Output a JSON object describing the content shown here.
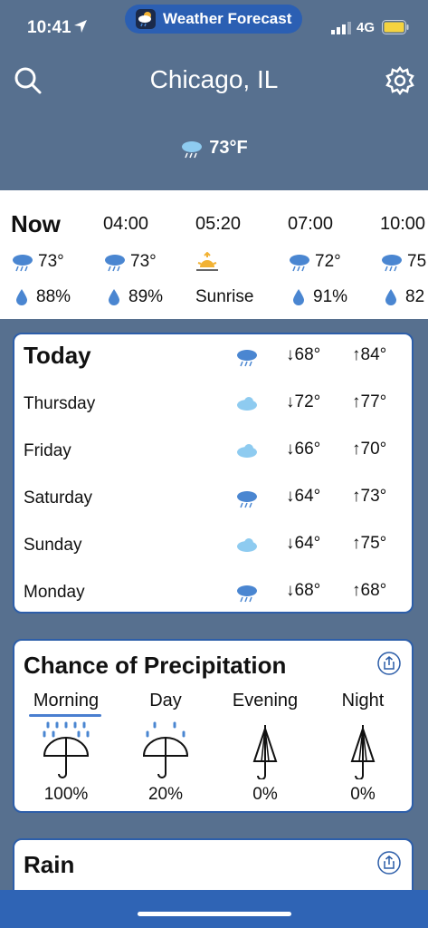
{
  "status": {
    "time": "10:41",
    "network": "4G"
  },
  "app": {
    "name": "Weather Forecast"
  },
  "header": {
    "city": "Chicago, IL",
    "current_temp": "73°F"
  },
  "hourly": [
    {
      "label": "Now",
      "temp": "73°",
      "precip": "88%",
      "icon": "rain-cloud-icon"
    },
    {
      "label": "04:00",
      "temp": "73°",
      "precip": "89%",
      "icon": "rain-cloud-icon"
    },
    {
      "label": "05:20",
      "event": "Sunrise",
      "icon": "sunrise-icon"
    },
    {
      "label": "07:00",
      "temp": "72°",
      "precip": "91%",
      "icon": "rain-cloud-icon"
    },
    {
      "label": "10:00",
      "temp": "75",
      "precip": "82",
      "icon": "rain-cloud-icon"
    }
  ],
  "daily": [
    {
      "day": "Today",
      "low": "↓68°",
      "high": "↑84°",
      "icon": "rain-cloud-icon"
    },
    {
      "day": "Thursday",
      "low": "↓72°",
      "high": "↑77°",
      "icon": "cloud-icon"
    },
    {
      "day": "Friday",
      "low": "↓66°",
      "high": "↑70°",
      "icon": "cloud-icon"
    },
    {
      "day": "Saturday",
      "low": "↓64°",
      "high": "↑73°",
      "icon": "rain-cloud-icon"
    },
    {
      "day": "Sunday",
      "low": "↓64°",
      "high": "↑75°",
      "icon": "cloud-icon"
    },
    {
      "day": "Monday",
      "low": "↓68°",
      "high": "↑68°",
      "icon": "rain-cloud-icon"
    }
  ],
  "precipitation": {
    "title": "Chance of Precipitation",
    "periods": [
      {
        "label": "Morning",
        "value": "100%",
        "icon": "umbrella-heavy-rain-icon",
        "selected": true
      },
      {
        "label": "Day",
        "value": "20%",
        "icon": "umbrella-light-rain-icon",
        "selected": false
      },
      {
        "label": "Evening",
        "value": "0%",
        "icon": "closed-umbrella-icon",
        "selected": false
      },
      {
        "label": "Night",
        "value": "0%",
        "icon": "closed-umbrella-icon",
        "selected": false
      }
    ]
  },
  "rain": {
    "title": "Rain"
  },
  "colors": {
    "background": "#57708f",
    "accent": "#2d5ea9",
    "rain_icon": "#4a86d1",
    "cloud_icon": "#8ecbf0",
    "sun_icon": "#f2b233"
  }
}
